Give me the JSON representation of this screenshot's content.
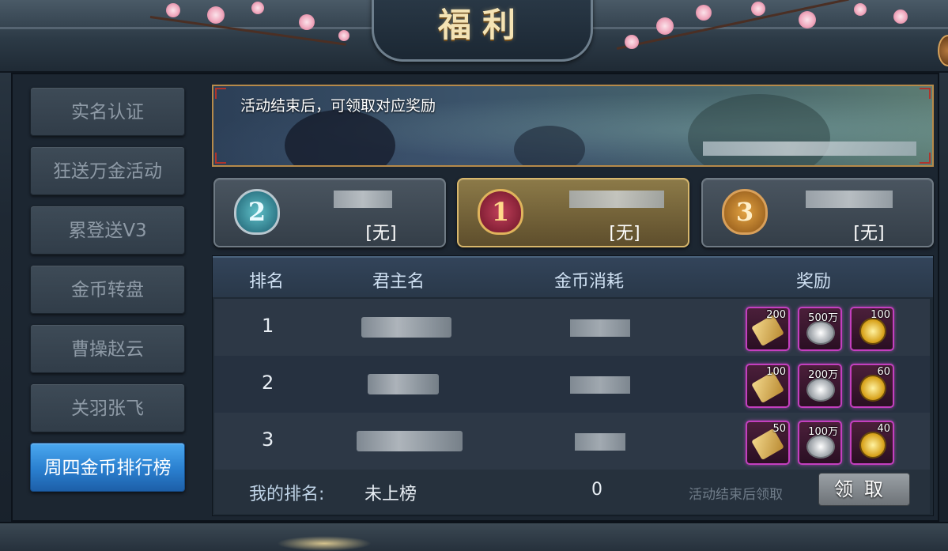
{
  "header": {
    "title": "福利"
  },
  "sidebar": {
    "items": [
      {
        "label": "实名认证",
        "active": false
      },
      {
        "label": "狂送万金活动",
        "active": false
      },
      {
        "label": "累登送V3",
        "active": false
      },
      {
        "label": "金币转盘",
        "active": false
      },
      {
        "label": "曹操赵云",
        "active": false
      },
      {
        "label": "关羽张飞",
        "active": false
      },
      {
        "label": "周四金币排行榜",
        "active": true
      }
    ]
  },
  "banner": {
    "notice": "活动结束后，可领取对应奖励"
  },
  "podium": [
    {
      "medal": "2",
      "status": "[无]"
    },
    {
      "medal": "1",
      "status": "[无]"
    },
    {
      "medal": "3",
      "status": "[无]"
    }
  ],
  "table": {
    "headers": {
      "rank": "排名",
      "name": "君主名",
      "coins": "金币消耗",
      "reward": "奖励"
    },
    "rows": [
      {
        "rank": "1",
        "rewards": [
          "200",
          "500万",
          "100"
        ]
      },
      {
        "rank": "2",
        "rewards": [
          "100",
          "200万",
          "60"
        ]
      },
      {
        "rank": "3",
        "rewards": [
          "50",
          "100万",
          "40"
        ]
      }
    ]
  },
  "my_rank": {
    "label": "我的排名:",
    "status": "未上榜",
    "coins": "0",
    "hint": "活动结束后领取",
    "claim_label": "领取"
  },
  "colors": {
    "active_tab": "#2a7fcf",
    "first_place_card": "#8c7a48",
    "reward_border": "#c43fbf"
  },
  "icons": {
    "reward_1": "scroll-icon",
    "reward_2": "silver-coin-icon",
    "reward_3": "gold-coin-icon"
  }
}
